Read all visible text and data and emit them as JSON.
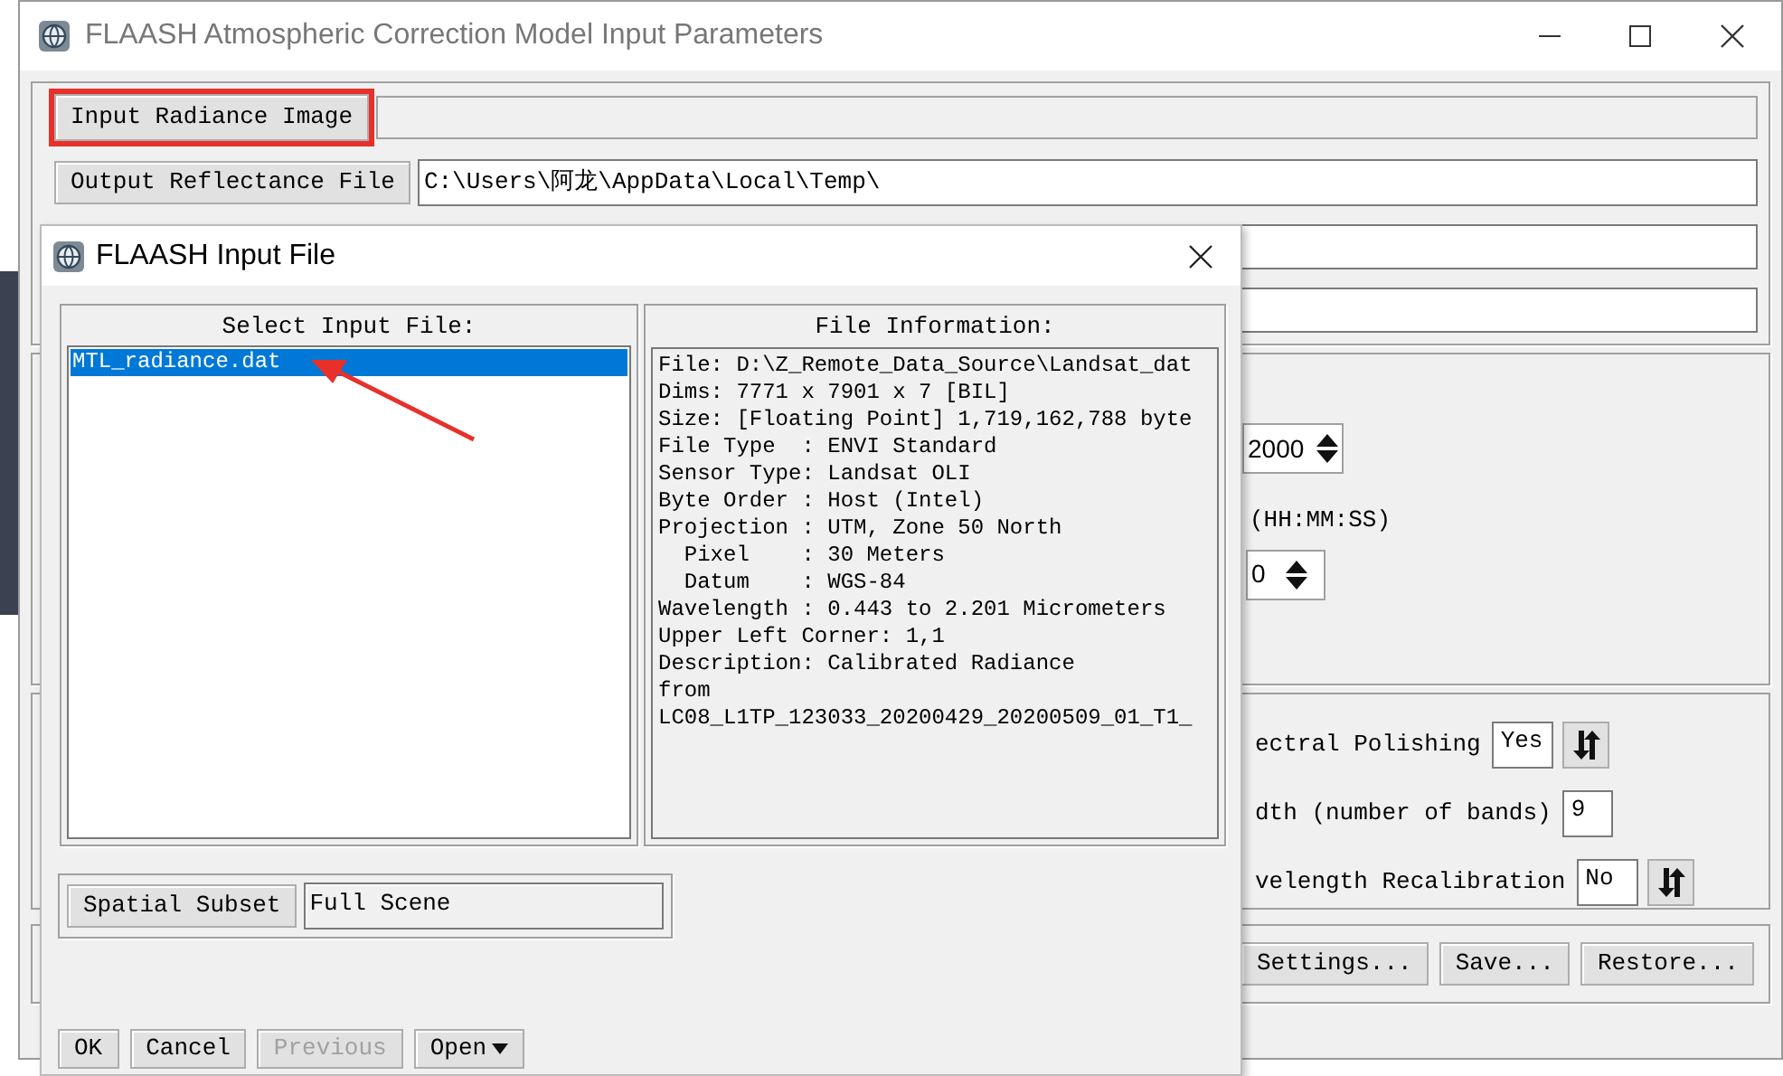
{
  "main_window": {
    "title": "FLAASH Atmospheric Correction Model Input Parameters",
    "input_button": {
      "label": "Input Radiance Image",
      "highlighted": true
    },
    "output_button": "Output Reflectance File",
    "output_value": "C:\\Users\\阿龙\\AppData\\Local\\Temp\\",
    "year_value": "2000",
    "time_label": "(HH:MM:SS)",
    "time_value": "0",
    "options": [
      {
        "label": "ectral Polishing",
        "value": "Yes",
        "kind": "toggle"
      },
      {
        "label": "dth (number of bands)",
        "value": "9",
        "kind": "field"
      },
      {
        "label": "velength Recalibration",
        "value": "No",
        "kind": "toggle"
      }
    ],
    "buttons": [
      "Settings...",
      "Save...",
      "Restore..."
    ]
  },
  "dialog": {
    "title": "FLAASH Input File",
    "list_label": "Select Input File:",
    "files": [
      {
        "name": "MTL_radiance.dat",
        "selected": true
      }
    ],
    "info_label": "File Information:",
    "info_lines": [
      "File: D:\\Z_Remote_Data_Source\\Landsat_dat",
      "Dims: 7771 x 7901 x 7 [BIL]",
      "Size: [Floating Point] 1,719,162,788 byte",
      "File Type  : ENVI Standard",
      "Sensor Type: Landsat OLI",
      "Byte Order : Host (Intel)",
      "Projection : UTM, Zone 50 North",
      "  Pixel    : 30 Meters",
      "  Datum    : WGS-84",
      "Wavelength : 0.443 to 2.201 Micrometers",
      "Upper Left Corner: 1,1",
      "Description: Calibrated Radiance",
      "from",
      "LC08_L1TP_123033_20200429_20200509_01_T1_"
    ],
    "subset_button": "Spatial Subset",
    "subset_value": "Full Scene",
    "buttons": [
      {
        "label": "OK",
        "disabled": false,
        "dropdown": false
      },
      {
        "label": "Cancel",
        "disabled": false,
        "dropdown": false
      },
      {
        "label": "Previous",
        "disabled": true,
        "dropdown": false
      },
      {
        "label": "Open",
        "disabled": false,
        "dropdown": true
      }
    ]
  }
}
